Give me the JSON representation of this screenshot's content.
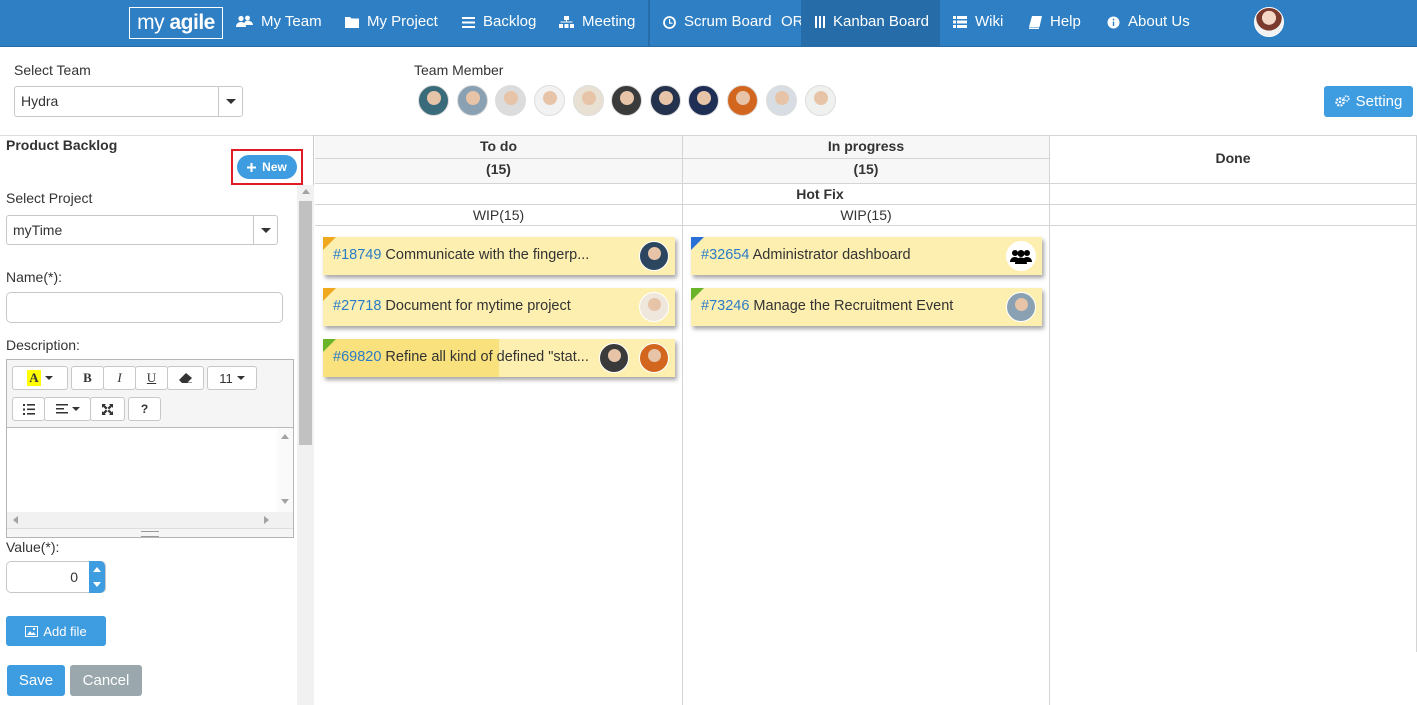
{
  "app": {
    "logo_prefix": "my ",
    "logo_brand": "agile"
  },
  "nav": {
    "my_team": "My Team",
    "my_project": "My Project",
    "backlog": "Backlog",
    "meeting": "Meeting",
    "scrum_board": "Scrum Board",
    "or": "OR",
    "kanban_board": "Kanban Board",
    "wiki": "Wiki",
    "help": "Help",
    "about_us": "About Us"
  },
  "team": {
    "select_label": "Select Team",
    "selected": "Hydra",
    "member_label": "Team Member",
    "setting_label": "Setting"
  },
  "backlog": {
    "title": "Product Backlog",
    "new_label": "New",
    "project_label": "Select Project",
    "project_selected": "myTime",
    "name_label": "Name(*):",
    "name_value": "",
    "description_label": "Description:",
    "font_size": "11",
    "bold": "B",
    "italic": "I",
    "underline": "U",
    "help": "?",
    "value_label": "Value(*):",
    "value": "0",
    "add_file_label": "Add file",
    "save_label": "Save",
    "cancel_label": "Cancel"
  },
  "board": {
    "columns": [
      {
        "title": "To do",
        "count": "(15)",
        "wip": "WIP(15)"
      },
      {
        "title": "In progress",
        "count": "(15)",
        "wip": "WIP(15)"
      },
      {
        "title": "Done"
      }
    ],
    "swimlane": "Hot Fix",
    "cards": [
      {
        "id": "#18749",
        "title": "Communicate with the fingerp...",
        "flag_color": "#f0a81e"
      },
      {
        "id": "#27718",
        "title": "Document for mytime project",
        "flag_color": "#f0a81e"
      },
      {
        "id": "#69820",
        "title": "Refine all kind of defined \"stat...",
        "flag_color": "#6ab42a",
        "progress_percent": 50
      },
      {
        "id": "#32654",
        "title": "Administrator dashboard",
        "flag_color": "#2a6fd6",
        "assignee_icon": "group-icon"
      },
      {
        "id": "#73246",
        "title": "Manage the Recruitment Event",
        "flag_color": "#6ab42a"
      }
    ]
  },
  "colors": {
    "navbar": "#2e7fc4",
    "primary_button": "#3e9ce0",
    "card_background": "#fcefb0",
    "highlight_box": "#e01b24"
  }
}
